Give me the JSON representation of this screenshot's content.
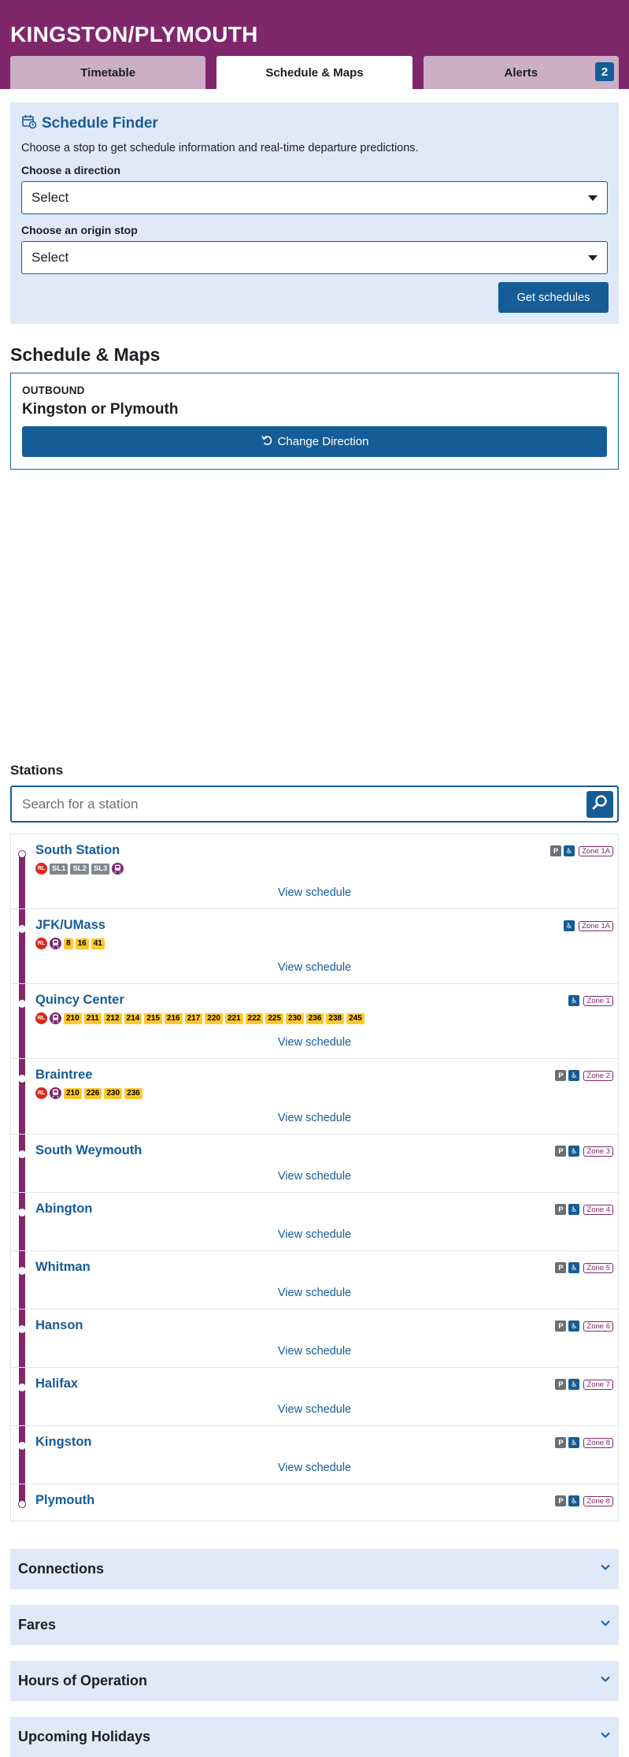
{
  "header": {
    "title": "KINGSTON/PLYMOUTH",
    "tabs": [
      {
        "label": "Timetable"
      },
      {
        "label": "Schedule & Maps"
      },
      {
        "label": "Alerts",
        "badge": "2"
      }
    ],
    "colors": {
      "route": "#80276c",
      "primary": "#165c96"
    }
  },
  "finder": {
    "title": "Schedule Finder",
    "description": "Choose a stop to get schedule information and real-time departure predictions.",
    "direction_label": "Choose a direction",
    "direction_value": "Select",
    "origin_label": "Choose an origin stop",
    "origin_value": "Select",
    "submit_label": "Get schedules"
  },
  "schedule": {
    "title": "Schedule & Maps",
    "direction_kicker": "OUTBOUND",
    "direction_name": "Kingston or Plymouth",
    "change_label": "Change Direction"
  },
  "stations": {
    "label": "Stations",
    "search_placeholder": "Search for a station",
    "view_label": "View schedule",
    "parking_icon_text": "P",
    "accessible_icon_text": "♿",
    "rl_text": "RL",
    "list": [
      {
        "name": "South Station",
        "zone": "Zone 1A",
        "parking": true,
        "rl": true,
        "silver": [
          "SL1",
          "SL2",
          "SL3"
        ],
        "cr": true,
        "buses": []
      },
      {
        "name": "JFK/UMass",
        "zone": "Zone 1A",
        "parking": false,
        "rl": true,
        "silver": [],
        "cr": true,
        "buses": [
          "8",
          "16",
          "41"
        ]
      },
      {
        "name": "Quincy Center",
        "zone": "Zone 1",
        "parking": false,
        "rl": true,
        "silver": [],
        "cr": true,
        "buses": [
          "210",
          "211",
          "212",
          "214",
          "215",
          "216",
          "217",
          "220",
          "221",
          "222",
          "225",
          "230",
          "236",
          "238",
          "245"
        ]
      },
      {
        "name": "Braintree",
        "zone": "Zone 2",
        "parking": true,
        "rl": true,
        "silver": [],
        "cr": true,
        "buses": [
          "210",
          "226",
          "230",
          "236"
        ]
      },
      {
        "name": "South Weymouth",
        "zone": "Zone 3",
        "parking": true
      },
      {
        "name": "Abington",
        "zone": "Zone 4",
        "parking": true
      },
      {
        "name": "Whitman",
        "zone": "Zone 5",
        "parking": true
      },
      {
        "name": "Hanson",
        "zone": "Zone 6",
        "parking": true
      },
      {
        "name": "Halifax",
        "zone": "Zone 7",
        "parking": true
      },
      {
        "name": "Kingston",
        "zone": "Zone 8",
        "parking": true
      },
      {
        "name": "Plymouth",
        "zone": "Zone 8",
        "parking": true
      }
    ]
  },
  "accordions": [
    {
      "title": "Connections"
    },
    {
      "title": "Fares"
    },
    {
      "title": "Hours of Operation"
    },
    {
      "title": "Upcoming Holidays"
    }
  ]
}
